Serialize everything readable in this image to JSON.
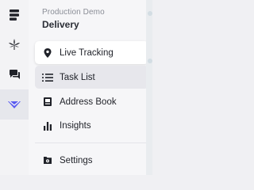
{
  "org": {
    "subtitle": "Production Demo",
    "title": "Delivery"
  },
  "rail": {
    "items": [
      {
        "icon": "brand-logo-icon"
      },
      {
        "icon": "cannabis-leaf-icon"
      },
      {
        "icon": "chat-icon"
      },
      {
        "icon": "delivery-route-icon",
        "active": true
      }
    ]
  },
  "nav": {
    "items": [
      {
        "label": "Live Tracking",
        "icon": "location-pin-icon",
        "state": "active"
      },
      {
        "label": "Task List",
        "icon": "list-icon",
        "state": "hover"
      },
      {
        "label": "Address Book",
        "icon": "address-book-icon"
      },
      {
        "label": "Insights",
        "icon": "bar-chart-icon"
      },
      {
        "label": "Settings",
        "icon": "settings-icon"
      }
    ]
  },
  "colors": {
    "accent": "#5b5cf0",
    "text": "#1f2128",
    "muted": "#8a8d96"
  }
}
